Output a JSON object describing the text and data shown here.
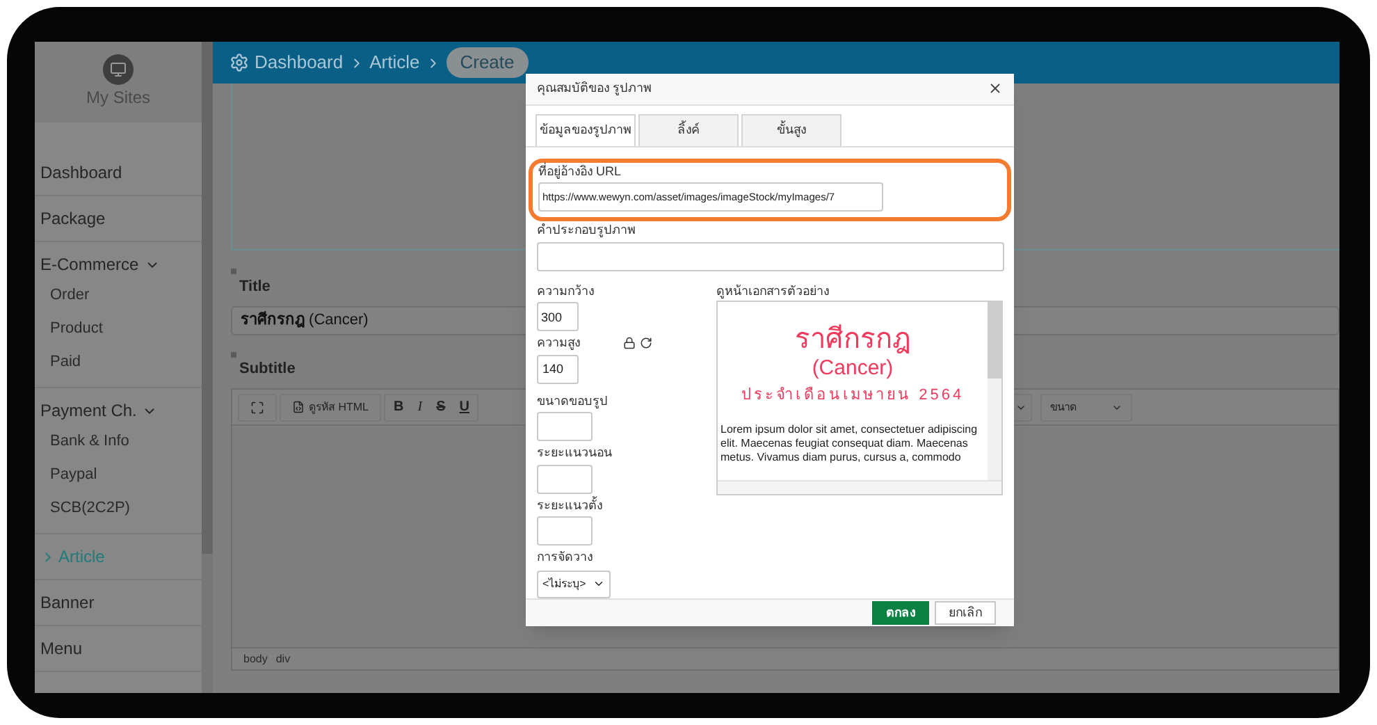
{
  "sidebar": {
    "brand": "My Sites",
    "items": [
      {
        "label": "Dashboard",
        "selected": false
      },
      {
        "label": "Package",
        "selected": false
      },
      {
        "label": "E-Commerce",
        "selected": false,
        "expanded": true,
        "children": [
          {
            "label": "Order",
            "selected": false
          },
          {
            "label": "Product",
            "selected": false
          },
          {
            "label": "Paid",
            "selected": false
          }
        ]
      },
      {
        "label": "Payment Ch.",
        "selected": false,
        "expanded": true,
        "children": [
          {
            "label": "Bank & Info",
            "selected": false
          },
          {
            "label": "Paypal",
            "selected": false
          },
          {
            "label": "SCB(2C2P)",
            "selected": false
          }
        ]
      },
      {
        "label": "Article",
        "selected": true
      },
      {
        "label": "Banner",
        "selected": false
      },
      {
        "label": "Menu",
        "selected": false
      }
    ]
  },
  "breadcrumb": [
    "Dashboard",
    "Article",
    "Create"
  ],
  "form": {
    "title": {
      "label": "Title",
      "value": "**ราศีกรกฎ** (Cancer)"
    },
    "subtitle": {
      "label": "Subtitle"
    },
    "editor": {
      "source_button": "ดูรหัส HTML",
      "format_buttons": [
        {
          "label": "B",
          "kind": "bold"
        },
        {
          "label": "I",
          "kind": "italic"
        },
        {
          "label": "S",
          "kind": "strike"
        },
        {
          "label": "U",
          "kind": "underline"
        }
      ],
      "size_dropdown": "ขนาด",
      "path": [
        "body",
        "div"
      ]
    }
  },
  "dialog": {
    "title": "คุณสมบัติของ รูปภาพ",
    "tabs": [
      {
        "label": "ข้อมูลของรูปภาพ",
        "selected": true
      },
      {
        "label": "ลิ้งค์",
        "selected": false
      },
      {
        "label": "ขั้นสูง",
        "selected": false
      }
    ],
    "url": {
      "label": "ที่อยู่อ้างอิง URL",
      "value": "https://www.wewyn.com/asset/images/imageStock/myImages/7",
      "highlighted": true
    },
    "alt": {
      "label": "คำประกอบรูปภาพ"
    },
    "width": {
      "label": "ความกว้าง",
      "value": "300"
    },
    "height": {
      "label": "ความสูง",
      "value": "140"
    },
    "border": {
      "label": "ขนาดขอบรูป"
    },
    "hspace": {
      "label": "ระยะแนวนอน"
    },
    "vspace": {
      "label": "ระยะแนวตั้ง"
    },
    "align": {
      "label": "การจัดวาง",
      "value": "<ไม่ระบุ>"
    },
    "preview": {
      "label": "ดูหน้าเอกสารตัวอย่าง",
      "heading": "ราศีกรกฎ",
      "subheading": "(Cancer)",
      "tagline": "ประจำเดือนเมษายน 2564",
      "body": "Lorem ipsum dolor sit amet, consectetuer adipiscing elit. Maecenas feugiat consequat diam. Maecenas metus. Vivamus diam purus, cursus a, commodo"
    },
    "buttons": [
      {
        "label": "ตกลง",
        "kind": "primary"
      },
      {
        "label": "ยกเลิก",
        "kind": "secondary"
      }
    ]
  }
}
